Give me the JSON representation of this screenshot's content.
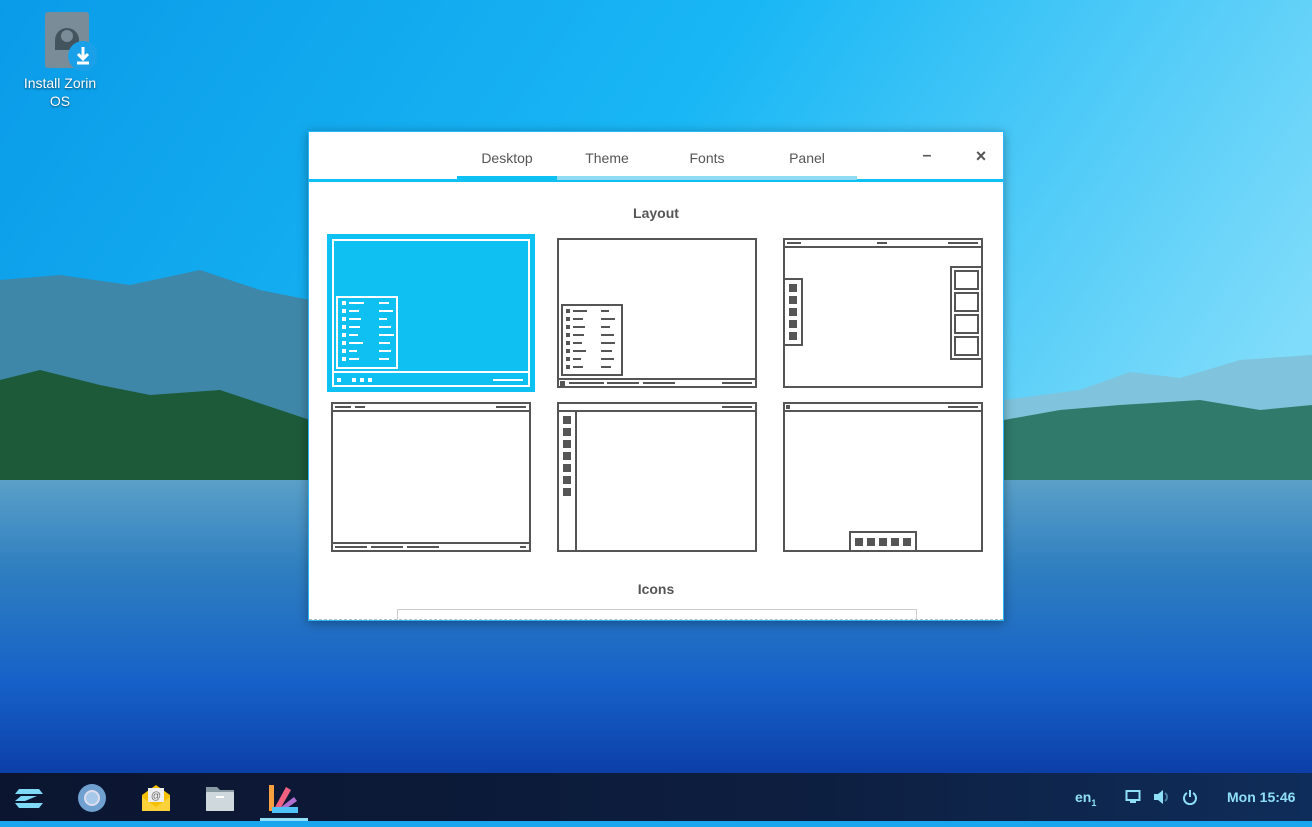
{
  "desktop": {
    "icons": [
      {
        "label": "Install Zorin OS",
        "icon": "installer-icon"
      }
    ]
  },
  "window": {
    "tabs": [
      {
        "label": "Desktop",
        "active": true
      },
      {
        "label": "Theme"
      },
      {
        "label": "Fonts"
      },
      {
        "label": "Panel"
      }
    ],
    "minimize_label": "–",
    "close_label": "×",
    "sections": {
      "layout": "Layout",
      "icons": "Icons"
    },
    "layouts": {
      "selected_index": 0,
      "count": 6
    },
    "accent": "#0fc0f2"
  },
  "panel": {
    "apps": [
      "zorin-menu-icon",
      "chromium-icon",
      "mail-icon",
      "files-icon",
      "appearance-icon"
    ],
    "active_app": "appearance-icon",
    "keyboard": "en",
    "keyboard_sub": "1",
    "clock": "Mon 15:46",
    "text_color": "#8fe0f7"
  }
}
